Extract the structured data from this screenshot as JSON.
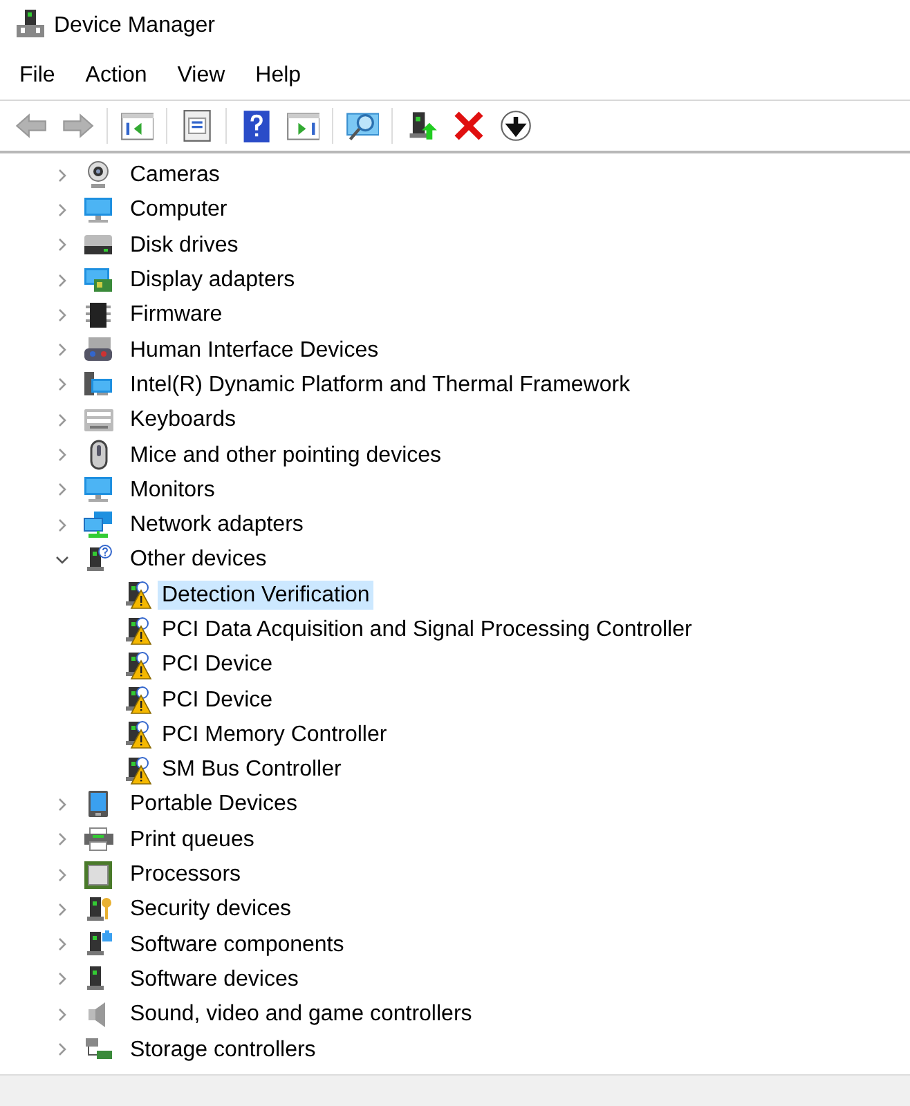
{
  "window": {
    "title": "Device Manager"
  },
  "menu": [
    "File",
    "Action",
    "View",
    "Help"
  ],
  "toolbar": [
    {
      "disabled": true
    },
    {
      "disabled": true
    },
    {
      "disabled": false
    },
    {
      "disabled": false
    },
    {
      "disabled": false
    },
    {
      "disabled": false
    },
    {
      "disabled": false
    },
    {
      "disabled": false
    },
    {
      "disabled": false
    },
    {
      "disabled": false
    }
  ],
  "tree": [
    {
      "label": "Cameras",
      "expanded": false
    },
    {
      "label": "Computer",
      "expanded": false
    },
    {
      "label": "Disk drives",
      "expanded": false
    },
    {
      "label": "Display adapters",
      "expanded": false
    },
    {
      "label": "Firmware",
      "expanded": false
    },
    {
      "label": "Human Interface Devices",
      "expanded": false
    },
    {
      "label": "Intel(R) Dynamic Platform and Thermal Framework",
      "expanded": false
    },
    {
      "label": "Keyboards",
      "expanded": false
    },
    {
      "label": "Mice and other pointing devices",
      "expanded": false
    },
    {
      "label": "Monitors",
      "expanded": false
    },
    {
      "label": "Network adapters",
      "expanded": false
    },
    {
      "label": "Other devices",
      "expanded": true,
      "children": [
        {
          "label": "Detection Verification",
          "selected": true
        },
        {
          "label": "PCI Data Acquisition and Signal Processing Controller",
          "selected": false
        },
        {
          "label": "PCI Device",
          "selected": false
        },
        {
          "label": "PCI Device",
          "selected": false
        },
        {
          "label": "PCI Memory Controller",
          "selected": false
        },
        {
          "label": "SM Bus Controller",
          "selected": false
        }
      ]
    },
    {
      "label": "Portable Devices",
      "expanded": false
    },
    {
      "label": "Print queues",
      "expanded": false
    },
    {
      "label": "Processors",
      "expanded": false
    },
    {
      "label": "Security devices",
      "expanded": false
    },
    {
      "label": "Software components",
      "expanded": false
    },
    {
      "label": "Software devices",
      "expanded": false
    },
    {
      "label": "Sound, video and game controllers",
      "expanded": false
    },
    {
      "label": "Storage controllers",
      "expanded": false
    }
  ]
}
